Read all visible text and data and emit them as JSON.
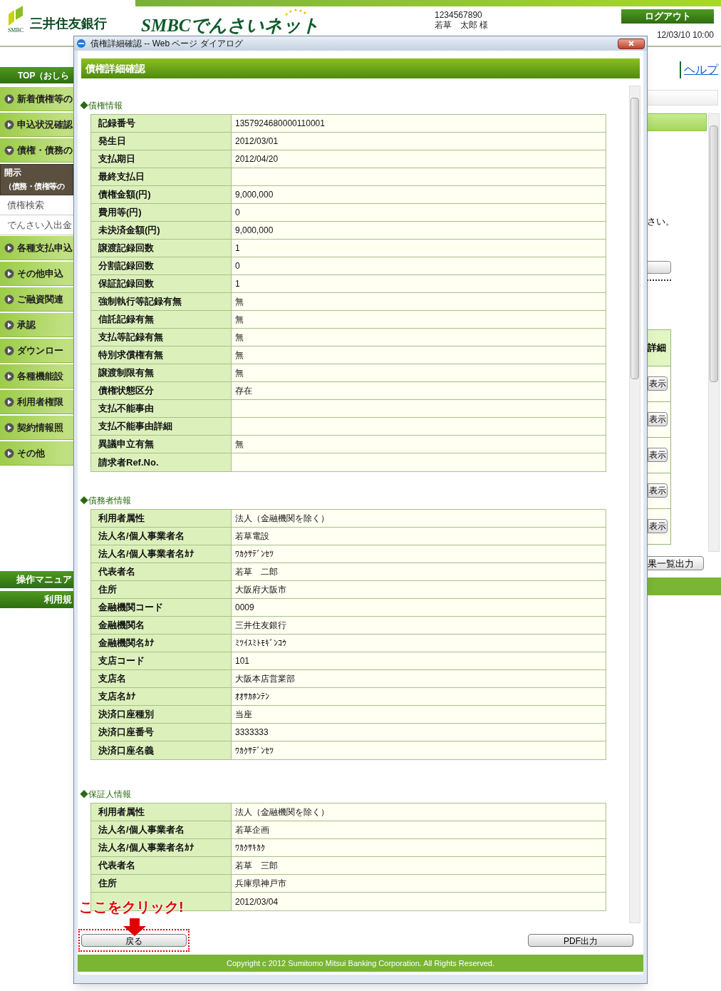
{
  "header": {
    "logo_caption": "SMBC",
    "bank_name": "三井住友銀行",
    "service_name": "SMBCでんさいネット",
    "user_id": "1234567890",
    "user_name": "若草　太郎 様",
    "logout": "ログアウト",
    "datetime": "12/03/10 10:00"
  },
  "sidebar": {
    "top": "TOP（おしら",
    "items": [
      {
        "kind": "menu",
        "label": "新着債権等の",
        "expanded": false
      },
      {
        "kind": "menu",
        "label": "申込状況確認",
        "expanded": false
      },
      {
        "kind": "menu",
        "label": "債権・債務の",
        "expanded": true
      },
      {
        "kind": "current",
        "label": "開示",
        "sublabel": "（債務・債権等の"
      },
      {
        "kind": "sub",
        "label": "債権検索"
      },
      {
        "kind": "sub",
        "label": "でんさい入出金"
      },
      {
        "kind": "menu",
        "label": "各種支払申込",
        "expanded": false
      },
      {
        "kind": "menu",
        "label": "その他申込",
        "expanded": false
      },
      {
        "kind": "menu",
        "label": "ご融資関連",
        "expanded": false
      },
      {
        "kind": "menu",
        "label": "承認",
        "expanded": false
      },
      {
        "kind": "menu",
        "label": "ダウンロー",
        "expanded": false
      },
      {
        "kind": "menu",
        "label": "各種機能設",
        "expanded": false
      },
      {
        "kind": "menu",
        "label": "利用者権限",
        "expanded": false
      },
      {
        "kind": "menu",
        "label": "契約情報照",
        "expanded": false
      },
      {
        "kind": "menu",
        "label": "その他",
        "expanded": false
      }
    ],
    "bottom": [
      "操作マニュア",
      "利用規"
    ]
  },
  "help": "ヘルプ",
  "background": {
    "fragment": "さい。",
    "table_header": "詳細",
    "row_buttons": [
      "表示",
      "表示",
      "表示",
      "表示",
      "表示"
    ],
    "export_button": "果一覧出力"
  },
  "dialog": {
    "title": "債権詳細確認 -- Web ページ ダイアログ",
    "heading": "債権詳細確認",
    "sections": [
      {
        "title": "◆債権情報",
        "rows": [
          {
            "label": "記録番号",
            "value": "1357924680000110001"
          },
          {
            "label": "発生日",
            "value": "2012/03/01"
          },
          {
            "label": "支払期日",
            "value": "2012/04/20"
          },
          {
            "label": "最終支払日"
          },
          {
            "label": "債権金額(円)",
            "value": "9,000,000"
          },
          {
            "label": "費用等(円)",
            "value": "0"
          },
          {
            "label": "未決済金額(円)",
            "value": "9,000,000"
          },
          {
            "label": "譲渡記録回数",
            "value": "1"
          },
          {
            "label": "分割記録回数",
            "value": "0"
          },
          {
            "label": "保証記録回数",
            "value": "1"
          },
          {
            "label": "強制執行等記録有無",
            "value": "無"
          },
          {
            "label": "信託記録有無",
            "value": "無"
          },
          {
            "label": "支払等記録有無",
            "value": "無"
          },
          {
            "label": "特別求償権有無",
            "value": "無"
          },
          {
            "label": "譲渡制限有無",
            "value": "無"
          },
          {
            "label": "債権状態区分",
            "value": "存在"
          },
          {
            "label": "支払不能事由"
          },
          {
            "label": "支払不能事由詳細"
          },
          {
            "label": "異議申立有無",
            "value": "無"
          },
          {
            "label": "請求者Ref.No."
          }
        ]
      },
      {
        "title": "◆債務者情報",
        "rows": [
          {
            "label": "利用者属性",
            "value": "法人（金融機関を除く）"
          },
          {
            "label": "法人名/個人事業者名",
            "value": "若草電設"
          },
          {
            "label": "法人名/個人事業者名ｶﾅ",
            "value": "ﾜｶｸｻﾃﾞﾝｾﾂ"
          },
          {
            "label": "代表者名",
            "value": "若草　二郎"
          },
          {
            "label": "住所",
            "value": "大阪府大阪市"
          },
          {
            "label": "金融機関コード",
            "value": "0009"
          },
          {
            "label": "金融機関名",
            "value": "三井住友銀行"
          },
          {
            "label": "金融機関名ｶﾅ",
            "value": "ﾐﾂｲｽﾐﾄﾓｷﾞﾝｺｳ"
          },
          {
            "label": "支店コード",
            "value": "101"
          },
          {
            "label": "支店名",
            "value": "大阪本店営業部"
          },
          {
            "label": "支店名ｶﾅ",
            "value": "ｵｵｻｶﾎﾝﾃﾝ"
          },
          {
            "label": "決済口座種別",
            "value": "当座"
          },
          {
            "label": "決済口座番号",
            "value": "3333333"
          },
          {
            "label": "決済口座名義",
            "value": "ﾜｶｸｻﾃﾞﾝｾﾂ"
          }
        ]
      },
      {
        "title": "◆保証人情報",
        "rows": [
          {
            "label": "利用者属性",
            "value": "法人（金融機関を除く）"
          },
          {
            "label": "法人名/個人事業者名",
            "value": "若草企画"
          },
          {
            "label": "法人名/個人事業者名ｶﾅ",
            "value": "ﾜｶｸｻｷｶｸ"
          },
          {
            "label": "代表者名",
            "value": "若草　三郎"
          },
          {
            "label": "住所",
            "value": "兵庫県神戸市"
          },
          {
            "value": "2012/03/04"
          }
        ]
      }
    ],
    "annotation": "ここをクリック!",
    "back_button": "戻る",
    "pdf_button": "PDF出力",
    "copyright": "Copyright c 2012 Sumitomo Mitsui Banking Corporation. All Rights Reserved."
  }
}
